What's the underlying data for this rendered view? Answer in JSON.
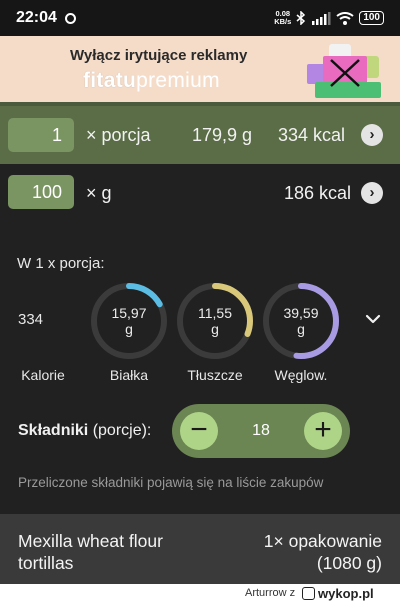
{
  "status_bar": {
    "time": "22:04",
    "speed_top": "0.08",
    "speed_bottom": "KB/s",
    "battery": "100"
  },
  "ad": {
    "title": "Wyłącz irytujące reklamy",
    "brand_bold": "fitatu",
    "brand_light": "premium"
  },
  "portion": {
    "qty": "1",
    "unit": "× porcja",
    "weight": "179,9 g",
    "kcal": "334 kcal"
  },
  "grams": {
    "qty": "100",
    "unit": "× g",
    "kcal": "186 kcal"
  },
  "nutrition": {
    "per_label": "W 1 x porcja:",
    "calories_value": "334",
    "calories_label": "Kalorie",
    "items": [
      {
        "value": "15,97",
        "unit": "g",
        "label": "Białka",
        "fraction": 0.17,
        "color": "#5bbde4"
      },
      {
        "value": "11,55",
        "unit": "g",
        "label": "Tłuszcze",
        "fraction": 0.31,
        "color": "#d9c87a"
      },
      {
        "value": "39,59",
        "unit": "g",
        "label": "Węglow.",
        "fraction": 0.52,
        "color": "#a99be3"
      }
    ]
  },
  "ingredients": {
    "label_bold": "Składniki",
    "label_rest": " (porcje):",
    "value": "18",
    "info": "Przeliczone składniki pojawią się na liście zakupów"
  },
  "product": {
    "name_line1": "Mexilla wheat flour",
    "name_line2": "tortillas",
    "amount_line1": "1× opakowanie",
    "amount_line2": "(1080 g)"
  },
  "footer": {
    "user": "Arturrow",
    "user_suffix": "z",
    "site": "wykop.pl"
  }
}
